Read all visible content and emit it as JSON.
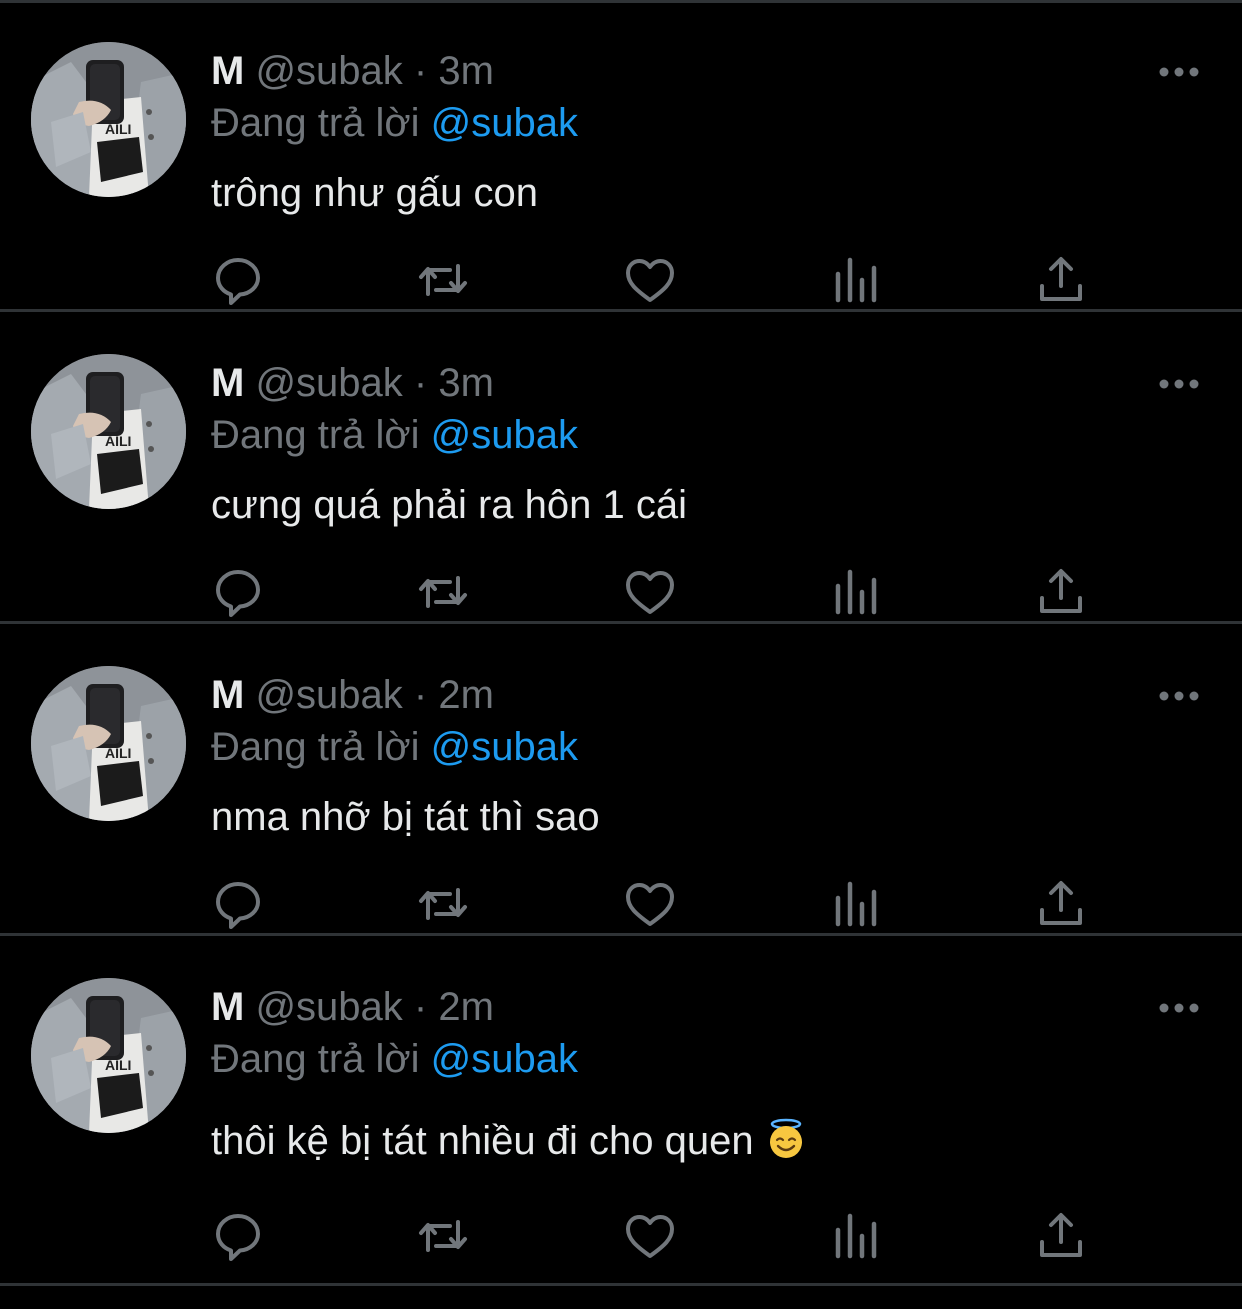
{
  "tweets": [
    {
      "name": "M",
      "handle": "@subak",
      "dot": "·",
      "time": "3m",
      "reply_prefix": "Đang trả lời",
      "reply_to": "@subak",
      "text": "trông như gấu con",
      "emoji": ""
    },
    {
      "name": "M",
      "handle": "@subak",
      "dot": "·",
      "time": "3m",
      "reply_prefix": "Đang trả lời",
      "reply_to": "@subak",
      "text": "cưng quá phải ra hôn 1 cái",
      "emoji": ""
    },
    {
      "name": "M",
      "handle": "@subak",
      "dot": "·",
      "time": "2m",
      "reply_prefix": "Đang trả lời",
      "reply_to": "@subak",
      "text": "nma nhỡ bị tát thì sao",
      "emoji": ""
    },
    {
      "name": "M",
      "handle": "@subak",
      "dot": "·",
      "time": "2m",
      "reply_prefix": "Đang trả lời",
      "reply_to": "@subak",
      "text": "thôi kệ bị tát nhiều đi cho quen",
      "emoji": "smiling-face-with-halo"
    }
  ],
  "colors": {
    "background": "#000000",
    "text": "#e7e9ea",
    "secondary": "#71767b",
    "mention": "#1d9bf0",
    "divider": "#2f3336"
  },
  "icons": {
    "reply": "reply-icon",
    "retweet": "retweet-icon",
    "like": "heart-icon",
    "views": "views-icon",
    "share": "share-icon",
    "more": "more-icon"
  }
}
